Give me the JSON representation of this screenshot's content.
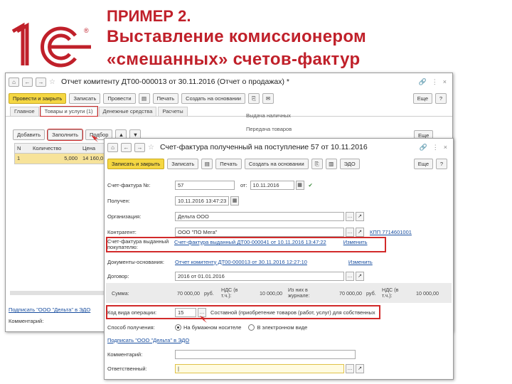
{
  "slide": {
    "title_line1": "ПРИМЕР 2.",
    "title_line2": "Выставление комиссионером",
    "title_line3": "«смешанных» счетов-фактур"
  },
  "logo": {
    "text": "1С",
    "registered": "®",
    "color": "#c0202a"
  },
  "back_window": {
    "title": "Отчет комитенту ДТ00-000013 от 30.11.2016 (Отчет о продажах) *",
    "toolbar": {
      "post_close": "Провести и закрыть",
      "save": "Записать",
      "post": "Провести",
      "print": "Печать",
      "create_based": "Создать на основании",
      "more": "Еще"
    },
    "tabs": [
      "Главное",
      "Товары и услуги (1)",
      "Денежные средства",
      "Расчеты"
    ],
    "side_labels": [
      "Выдача наличных",
      "Передача товаров"
    ],
    "table_toolbar": {
      "add": "Добавить",
      "fill": "Заполнить",
      "pick": "Подбор",
      "more": "Еще"
    },
    "columns": [
      "N",
      "Количество",
      "Цена"
    ],
    "rows": [
      {
        "n": "1",
        "qty": "5,000",
        "price": "14 160,0"
      }
    ],
    "footer_link": "Подписать \"ООО \"Дельта\" в ЭДО",
    "comment_label": "Комментарий:"
  },
  "front_window": {
    "title": "Счет-фактура полученный на поступление 57 от 10.11.2016",
    "toolbar": {
      "post_close": "Записать и закрыть",
      "save": "Записать",
      "print": "Печать",
      "create_based": "Создать на основании",
      "edo": "ЭДО",
      "more": "Еще"
    },
    "fields": {
      "number_label": "Счет-фактура №:",
      "number_value": "57",
      "from_label": "от:",
      "date_value": "10.11.2016",
      "received_label": "Получен:",
      "received_value": "10.11.2016 13:47:23",
      "org_label": "Организация:",
      "org_value": "Дельта ООО",
      "contractor_label": "Контрагент:",
      "contractor_value": "ООО \"ПО Мега\"",
      "kpp": "КПП 7714601001",
      "invoice_issued_label": "Счет-фактура выданный",
      "invoice_issued_label2": "покупателю:",
      "invoice_issued_value": "Счет-фактура выданный ДТ00-000041 от 10.11.2016 13:47:22",
      "change1": "Изменить",
      "basis_label": "Документы-основания:",
      "basis_value": "Отчет комитенту ДТ00-000013 от 30.11.2016 12:27:10",
      "change2": "Изменить",
      "contract_label": "Договор:",
      "contract_value": "2016 от 01.01.2016"
    },
    "sums": {
      "sum_label": "Сумма:",
      "sum_value": "70 000,00",
      "currency1": "руб.",
      "vat_incl_label": "НДС (в т.ч.):",
      "vat_value": "10 000,00",
      "from_journal_label": "Из них в журнале:",
      "sum2": "70 000,00",
      "currency2": "руб.",
      "vat2_label": "НДС (в т.ч.):",
      "vat2_value": "10 000,00"
    },
    "op_code_label": "Код вида операции:",
    "op_code_value": "15",
    "op_code_desc": "Составной (приобретение товаров (работ, услуг) для собственных",
    "method_label": "Способ получения:",
    "method_paper": "На бумажном носителе",
    "method_electronic": "В электронном виде",
    "sign_link": "Подписать \"ООО \"Дельта\" в ЭДО",
    "comment_label": "Комментарий:",
    "responsible_label": "Ответственный:"
  }
}
